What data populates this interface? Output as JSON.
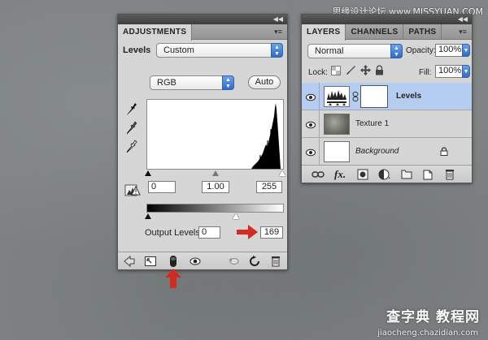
{
  "watermark": {
    "top": "思缘设计论坛 www.MISSYUAN.COM",
    "bottom_main": "查字典 教程网",
    "bottom_url": "jiaocheng.chazidian.com"
  },
  "adjustments": {
    "tab_label": "ADJUSTMENTS",
    "type_label": "Levels",
    "preset_value": "Custom",
    "channel_value": "RGB",
    "auto_label": "Auto",
    "input_black": "0",
    "input_gamma": "1.00",
    "input_white": "255",
    "output_label": "Output Levels:",
    "output_black": "0",
    "output_white": "169",
    "accent_color": "#2f6cc9",
    "highlight_color": "#d32a23"
  },
  "layers": {
    "tabs": [
      "LAYERS",
      "CHANNELS",
      "PATHS"
    ],
    "blend_mode": "Normal",
    "opacity_label": "Opacity:",
    "opacity_value": "100%",
    "lock_label": "Lock:",
    "fill_label": "Fill:",
    "fill_value": "100%",
    "rows": [
      {
        "name": "Levels",
        "selected": true
      },
      {
        "name": "Texture 1",
        "selected": false
      },
      {
        "name": "Background",
        "selected": false,
        "locked": true
      }
    ],
    "selection_color": "#b5cdf0"
  }
}
